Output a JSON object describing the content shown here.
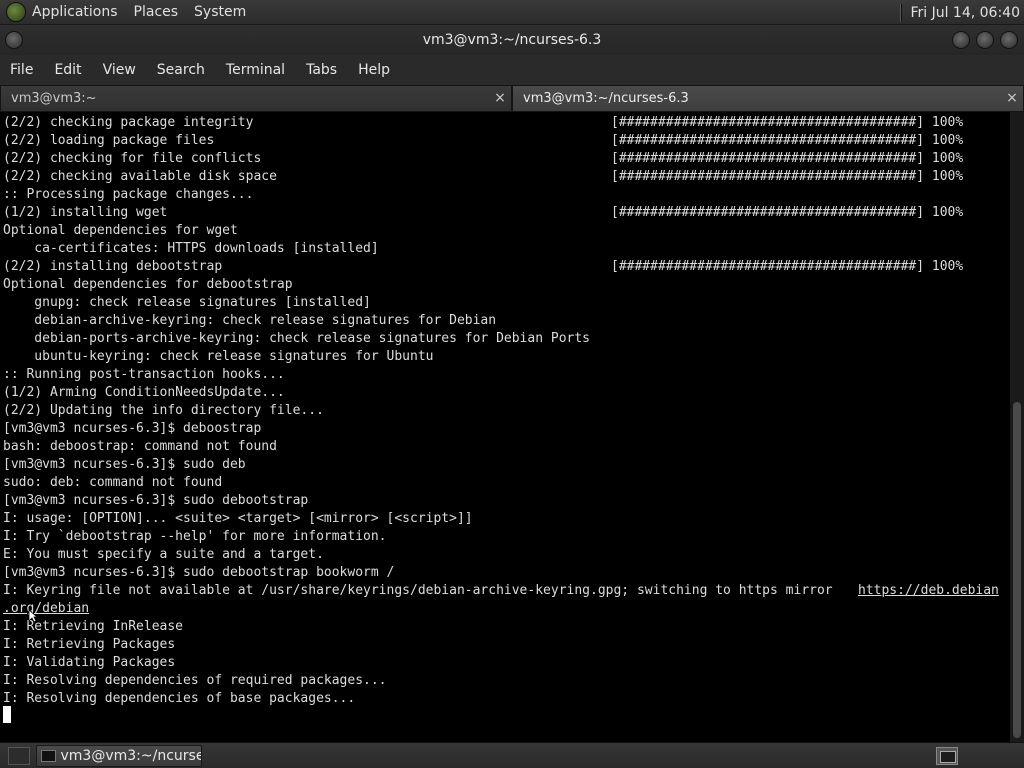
{
  "top_panel": {
    "menus": [
      "Applications",
      "Places",
      "System"
    ],
    "clock": "Fri Jul 14, 06:40"
  },
  "window": {
    "title": "vm3@vm3:~/ncurses-6.3"
  },
  "menubar": {
    "items": [
      "File",
      "Edit",
      "View",
      "Search",
      "Terminal",
      "Tabs",
      "Help"
    ]
  },
  "tabs": [
    {
      "label": "vm3@vm3:~",
      "close": "×"
    },
    {
      "label": "vm3@vm3:~/ncurses-6.3",
      "close": "×"
    }
  ],
  "terminal": {
    "lines": [
      "(2/2) checking package integrity",
      "(2/2) loading package files",
      "(2/2) checking for file conflicts",
      "(2/2) checking available disk space",
      ":: Processing package changes...",
      "(1/2) installing wget",
      "Optional dependencies for wget",
      "    ca-certificates: HTTPS downloads [installed]",
      "(2/2) installing debootstrap",
      "Optional dependencies for debootstrap",
      "    gnupg: check release signatures [installed]",
      "    debian-archive-keyring: check release signatures for Debian",
      "    debian-ports-archive-keyring: check release signatures for Debian Ports",
      "    ubuntu-keyring: check release signatures for Ubuntu",
      ":: Running post-transaction hooks...",
      "(1/2) Arming ConditionNeedsUpdate...",
      "(2/2) Updating the info directory file...",
      "[vm3@vm3 ncurses-6.3]$ deboostrap",
      "bash: deboostrap: command not found",
      "[vm3@vm3 ncurses-6.3]$ sudo deb",
      "sudo: deb: command not found",
      "[vm3@vm3 ncurses-6.3]$ sudo debootstrap",
      "I: usage: [OPTION]... <suite> <target> [<mirror> [<script>]]",
      "I: Try `debootstrap --help' for more information.",
      "E: You must specify a suite and a target.",
      "[vm3@vm3 ncurses-6.3]$ sudo debootstrap bookworm /",
      "I: Keyring file not available at /usr/share/keyrings/debian-archive-keyring.gpg; switching to https mirror ",
      "I: Retrieving InRelease",
      "I: Retrieving Packages",
      "I: Validating Packages",
      "I: Resolving dependencies of required packages...",
      "I: Resolving dependencies of base packages..."
    ],
    "url_part1": "https://deb.debian",
    "url_part2": ".org/debian",
    "progress_bars": [
      "[######################################] 100%",
      "[######################################] 100%",
      "[######################################] 100%",
      "[######################################] 100%",
      "[######################################] 100%",
      "[######################################] 100%"
    ]
  },
  "bottom_panel": {
    "task_label": "vm3@vm3:~/ncurse..."
  }
}
